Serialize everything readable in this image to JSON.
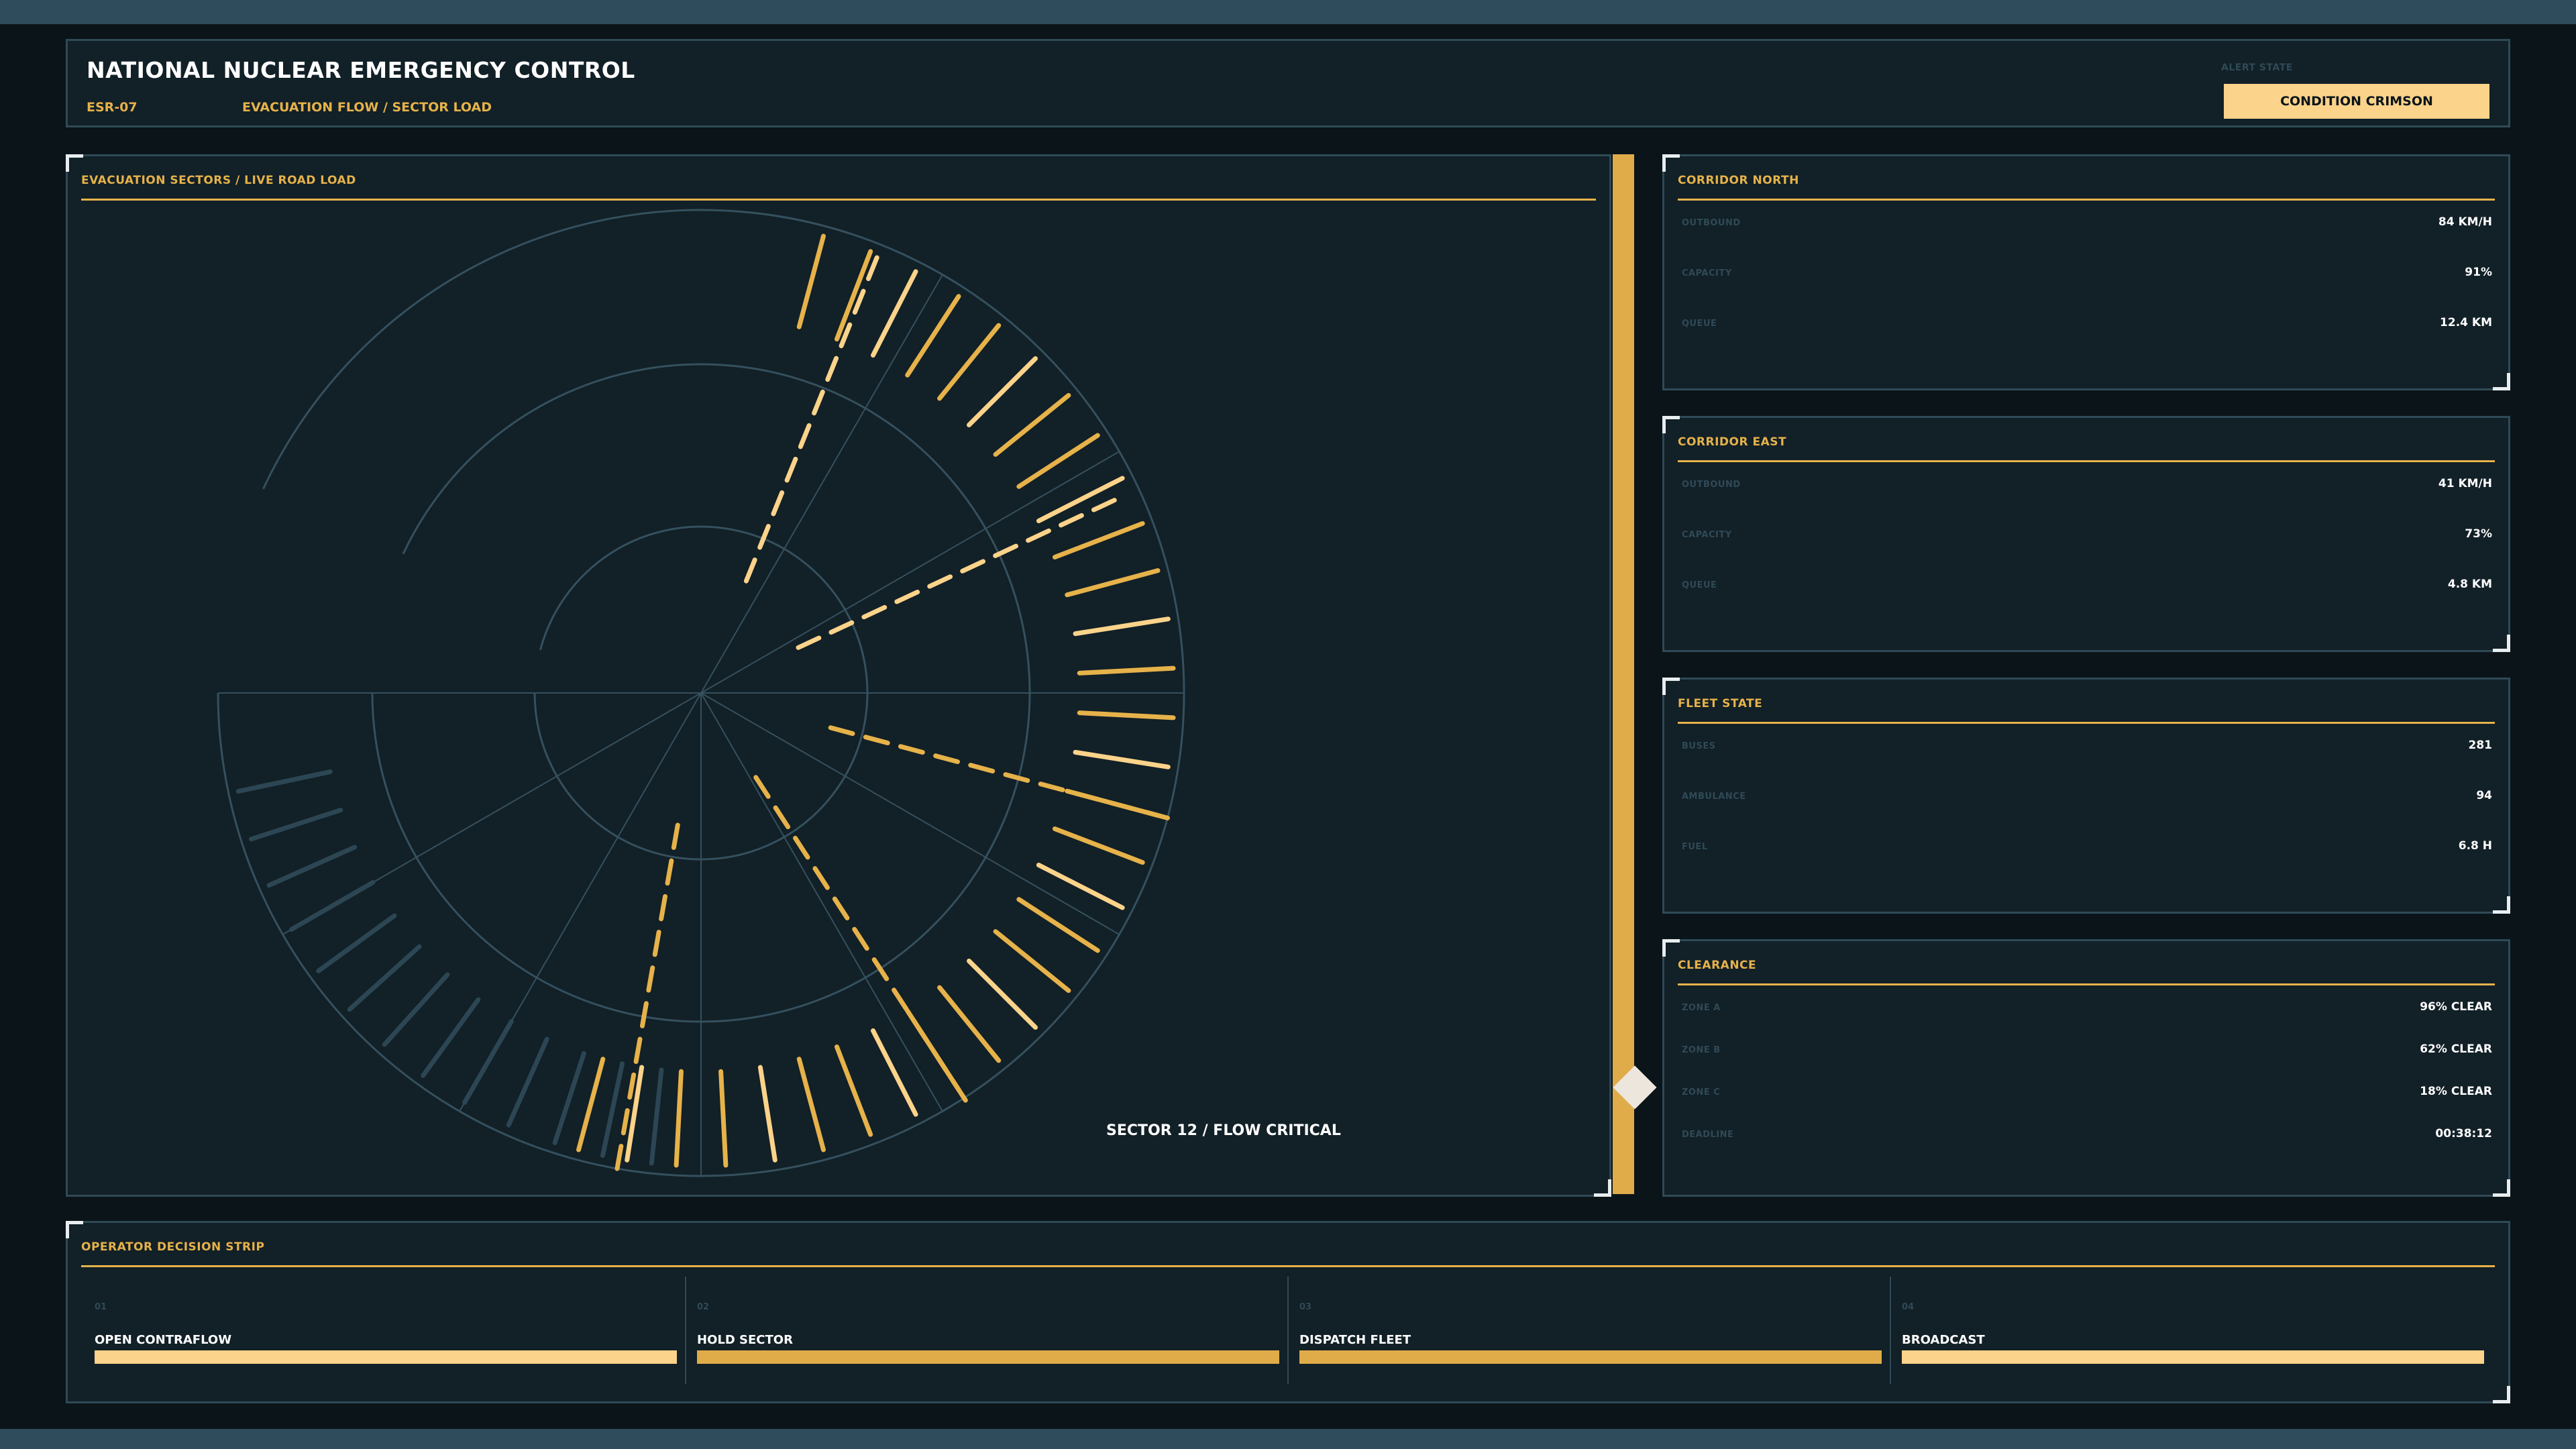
{
  "header": {
    "title": "NATIONAL NUCLEAR EMERGENCY CONTROL",
    "system_code": "ESR-07",
    "view_name": "EVACUATION FLOW / SECTOR LOAD",
    "alert_label": "ALERT STATE",
    "alert_value": "CONDITION CRIMSON"
  },
  "map": {
    "title": "EVACUATION SECTORS / LIVE ROAD LOAD",
    "sector_status": "SECTOR 12 / FLOW CRITICAL"
  },
  "cards": [
    {
      "title": "CORRIDOR NORTH",
      "rows": [
        {
          "label": "OUTBOUND",
          "value": "84 KM/H"
        },
        {
          "label": "CAPACITY",
          "value": "91%"
        },
        {
          "label": "QUEUE",
          "value": "12.4 KM"
        }
      ]
    },
    {
      "title": "CORRIDOR EAST",
      "rows": [
        {
          "label": "OUTBOUND",
          "value": "41 KM/H"
        },
        {
          "label": "CAPACITY",
          "value": "73%"
        },
        {
          "label": "QUEUE",
          "value": "4.8 KM"
        }
      ]
    },
    {
      "title": "FLEET STATE",
      "rows": [
        {
          "label": "BUSES",
          "value": "281"
        },
        {
          "label": "AMBULANCE",
          "value": "94"
        },
        {
          "label": "FUEL",
          "value": "6.8 H"
        }
      ]
    },
    {
      "title": "CLEARANCE",
      "rows": [
        {
          "label": "ZONE A",
          "value": "96% CLEAR"
        },
        {
          "label": "ZONE B",
          "value": "62% CLEAR"
        },
        {
          "label": "ZONE C",
          "value": "18% CLEAR"
        },
        {
          "label": "DEADLINE",
          "value": "00:38:12"
        }
      ]
    }
  ],
  "decision_strip": {
    "title": "OPERATOR DECISION STRIP",
    "options": [
      {
        "num": "01",
        "label": "OPEN CONTRAFLOW"
      },
      {
        "num": "02",
        "label": "HOLD SECTOR"
      },
      {
        "num": "03",
        "label": "DISPATCH FLEET"
      },
      {
        "num": "04",
        "label": "BROADCAST"
      }
    ]
  },
  "colors": {
    "accent": "#e6b24a",
    "accent_light": "#fbd38a",
    "panel": "#122027",
    "border": "#2f4a57",
    "muted_track": "#2c4654"
  }
}
